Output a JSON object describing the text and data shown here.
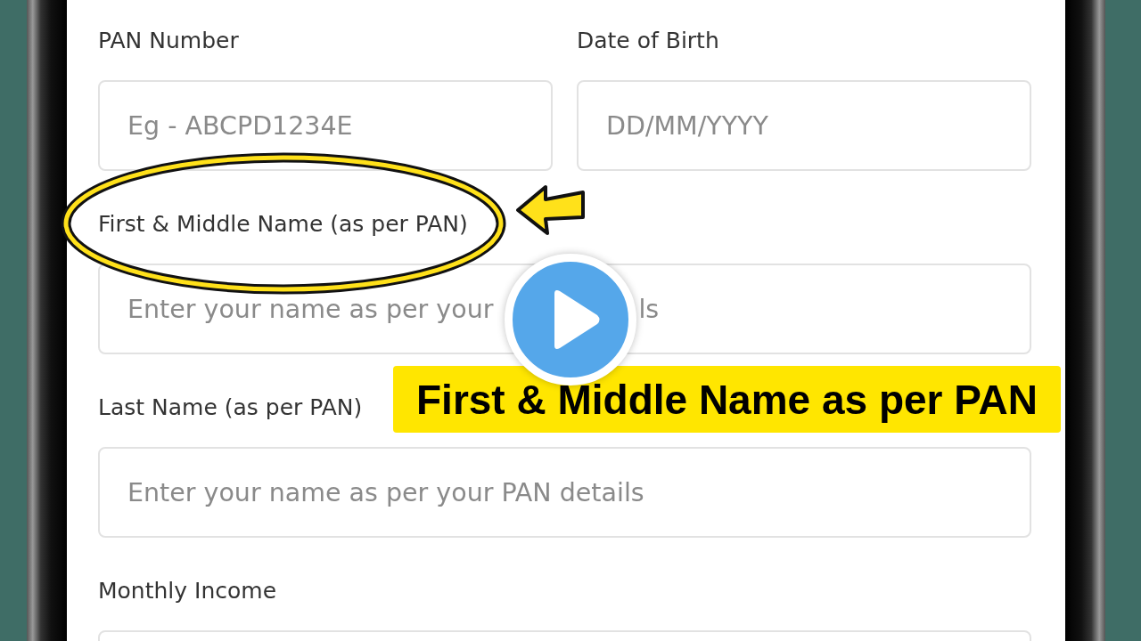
{
  "form": {
    "rows": [
      {
        "fields": [
          {
            "label": "PAN Number",
            "placeholder": "Eg - ABCPD1234E"
          },
          {
            "label": "Date of Birth",
            "placeholder": "DD/MM/YYYY"
          }
        ]
      },
      {
        "fields": [
          {
            "label": "First & Middle Name (as per PAN)",
            "placeholder": "Enter your name as per your",
            "placeholder_tail": "ls"
          }
        ]
      },
      {
        "fields": [
          {
            "label": "Last Name (as per PAN)",
            "placeholder": "Enter your name as per your PAN details"
          }
        ]
      },
      {
        "fields": [
          {
            "label": "Monthly Income"
          }
        ]
      }
    ]
  },
  "overlay": {
    "caption": "First & Middle Name as per PAN"
  }
}
